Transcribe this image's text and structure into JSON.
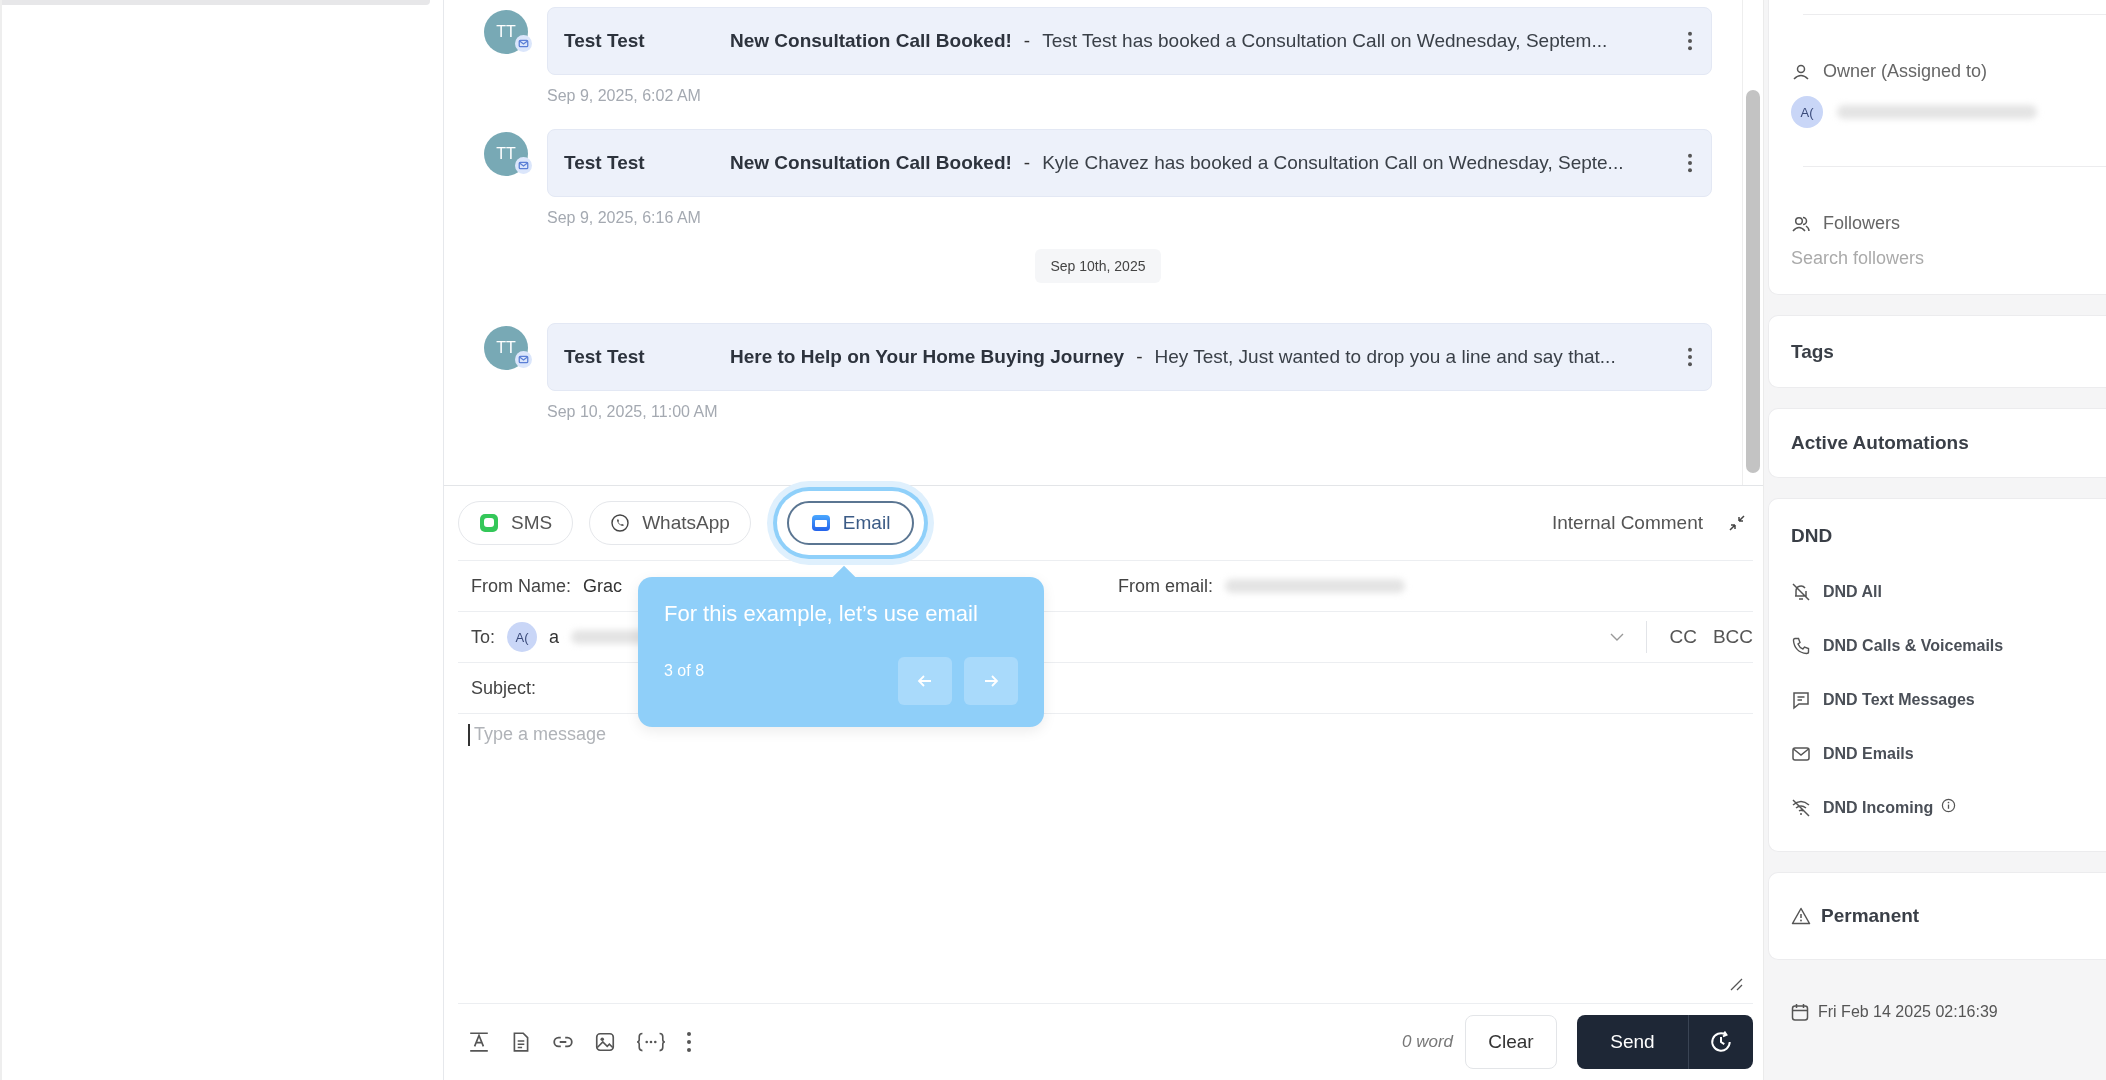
{
  "thread": [
    {
      "kind": "message",
      "avatar": "TT",
      "sender": "Test Test",
      "subject": "New Consultation Call Booked!",
      "separator": "-",
      "preview": "Test Test has booked a Consultation Call on Wednesday, Septem...",
      "time": "Sep 9, 2025, 6:02 AM"
    },
    {
      "kind": "message",
      "avatar": "TT",
      "sender": "Test Test",
      "subject": "New Consultation Call Booked!",
      "separator": "-",
      "preview": "Kyle Chavez has booked a Consultation Call on Wednesday, Septe...",
      "time": "Sep 9, 2025, 6:16 AM"
    },
    {
      "kind": "date",
      "label": "Sep 10th, 2025"
    },
    {
      "kind": "message",
      "avatar": "TT",
      "sender": "Test Test",
      "subject": "Here to Help on Your Home Buying Journey",
      "separator": "-",
      "preview": "Hey Test, Just wanted to drop you a line and say that...",
      "time": "Sep 10, 2025, 11:00 AM"
    }
  ],
  "composer": {
    "channels": [
      {
        "label": "SMS",
        "kind": "sms",
        "selected": false
      },
      {
        "label": "WhatsApp",
        "kind": "whatsapp",
        "selected": false
      },
      {
        "label": "Email",
        "kind": "email",
        "selected": true
      }
    ],
    "internal_comment": "Internal Comment",
    "from_name_label": "From Name:",
    "from_name_value": "Grac",
    "from_email_label": "From email:",
    "to_label": "To:",
    "to_avatar": "A(",
    "to_value": "a",
    "cc": "CC",
    "bcc": "BCC",
    "subject_label": "Subject:",
    "message_placeholder": "Type a message",
    "word_count": "0 word",
    "clear": "Clear",
    "send": "Send"
  },
  "tour_tooltip": {
    "text": "For this example, let’s use email",
    "step": "3 of 8"
  },
  "sidebar": {
    "owner_label": "Owner (Assigned to)",
    "owner_avatar": "A(",
    "followers_label": "Followers",
    "followers_placeholder": "Search followers",
    "sections": [
      "Tags",
      "Active Automations"
    ],
    "dnd": {
      "title": "DND",
      "items": [
        {
          "label": "DND All",
          "kind": "all"
        },
        {
          "label": "DND Calls & Voicemails",
          "kind": "calls"
        },
        {
          "label": "DND Text Messages",
          "kind": "text"
        },
        {
          "label": "DND Emails",
          "kind": "emails"
        },
        {
          "label": "DND Incoming",
          "kind": "incoming"
        }
      ]
    },
    "permanent": "Permanent",
    "date": "Fri Feb 14 2025 02:16:39"
  }
}
